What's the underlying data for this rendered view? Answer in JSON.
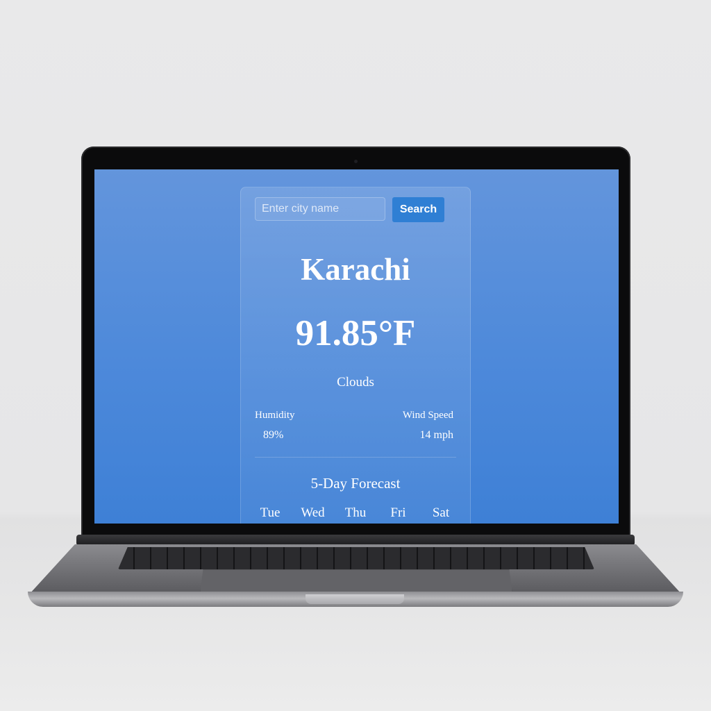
{
  "search": {
    "placeholder": "Enter city name",
    "button_label": "Search"
  },
  "weather": {
    "city": "Karachi",
    "temperature": "91.85°F",
    "condition": "Clouds",
    "humidity_label": "Humidity",
    "humidity_value": "89%",
    "wind_label": "Wind Speed",
    "wind_value": "14 mph"
  },
  "forecast": {
    "title": "5-Day Forecast",
    "days": [
      "Tue",
      "Wed",
      "Thu",
      "Fri",
      "Sat"
    ]
  },
  "colors": {
    "screen_background": "#4d89da",
    "button": "#2f7fd4",
    "text": "#ffffff"
  }
}
